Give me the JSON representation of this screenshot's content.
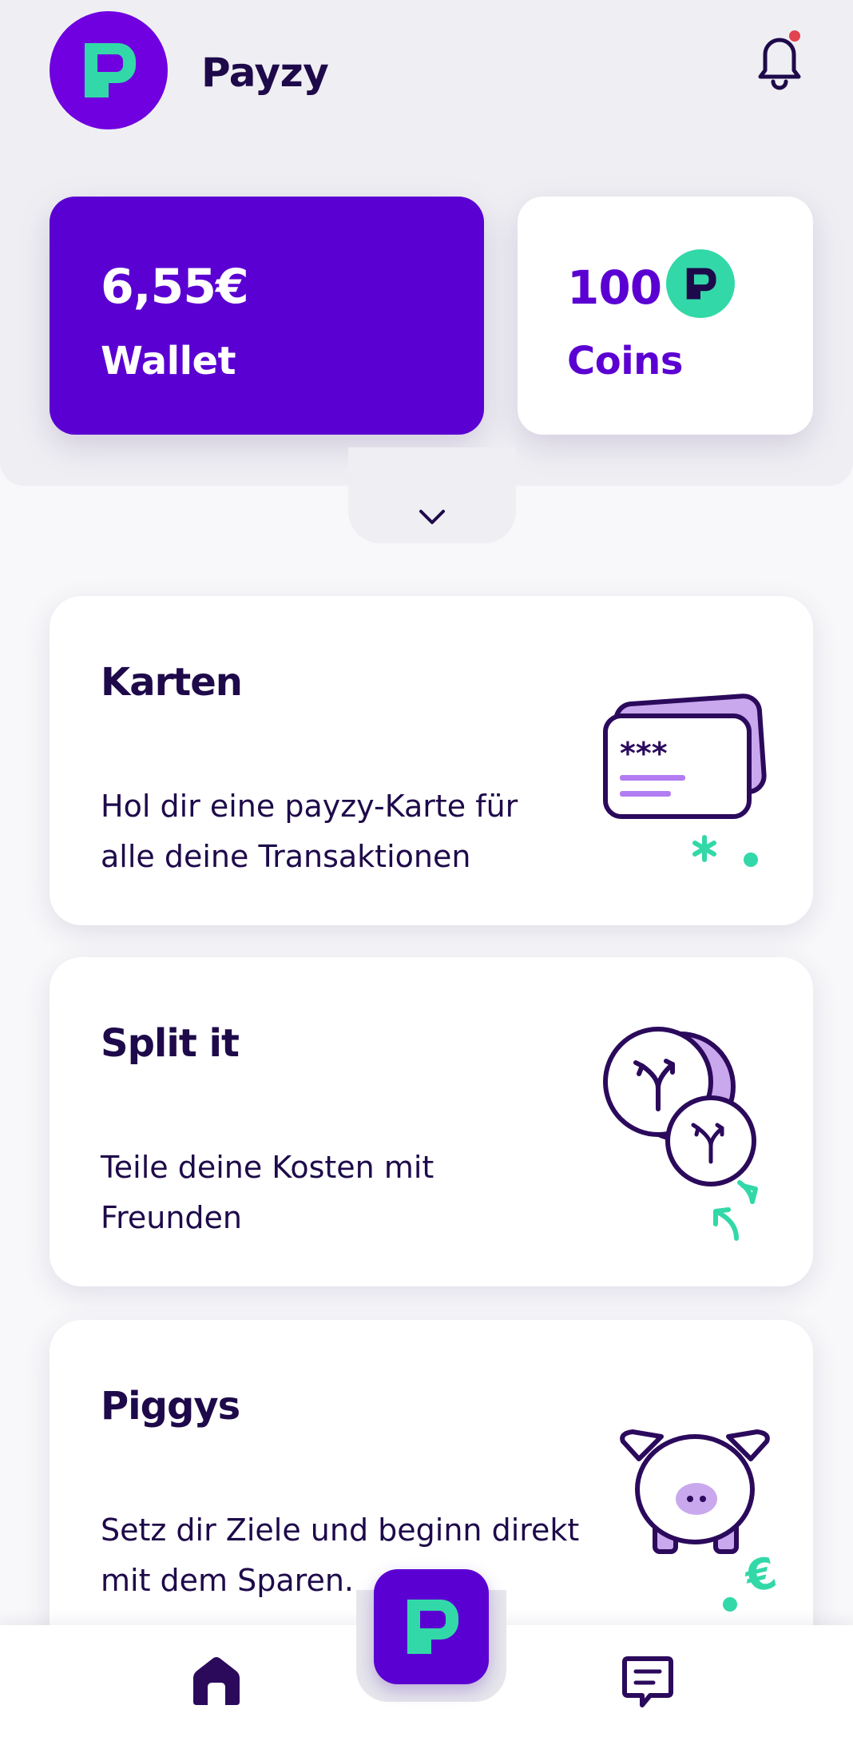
{
  "app": {
    "name": "Payzy",
    "logo_icon": "payzy-logo-icon"
  },
  "header": {
    "notification_icon": "bell-icon",
    "has_unread": true
  },
  "balances": {
    "wallet": {
      "amount": "6,55€",
      "label": "Wallet"
    },
    "coins": {
      "amount": "100",
      "label": "Coins",
      "icon": "coin-icon"
    }
  },
  "expand": {
    "icon": "chevron-down-icon"
  },
  "features": [
    {
      "title": "Karten",
      "description": "Hol dir eine payzy-Karte für alle deine Transaktionen",
      "icon": "card-illustration"
    },
    {
      "title": "Split it",
      "description": "Teile deine Kosten mit Freunden",
      "icon": "split-coins-illustration"
    },
    {
      "title": "Piggys",
      "description": "Setz dir Ziele und beginn direkt mit dem Sparen.",
      "icon": "piggy-bank-illustration"
    }
  ],
  "bottom_nav": {
    "items": [
      {
        "name": "home",
        "icon": "home-icon"
      },
      {
        "name": "payzy",
        "icon": "payzy-logo-icon"
      },
      {
        "name": "messages",
        "icon": "chat-icon"
      }
    ]
  },
  "colors": {
    "primary": "#5b00d2",
    "accent": "#33d8a8",
    "text": "#1e0a4a",
    "notification_dot": "#e2434f",
    "panel": "#efeff3"
  }
}
